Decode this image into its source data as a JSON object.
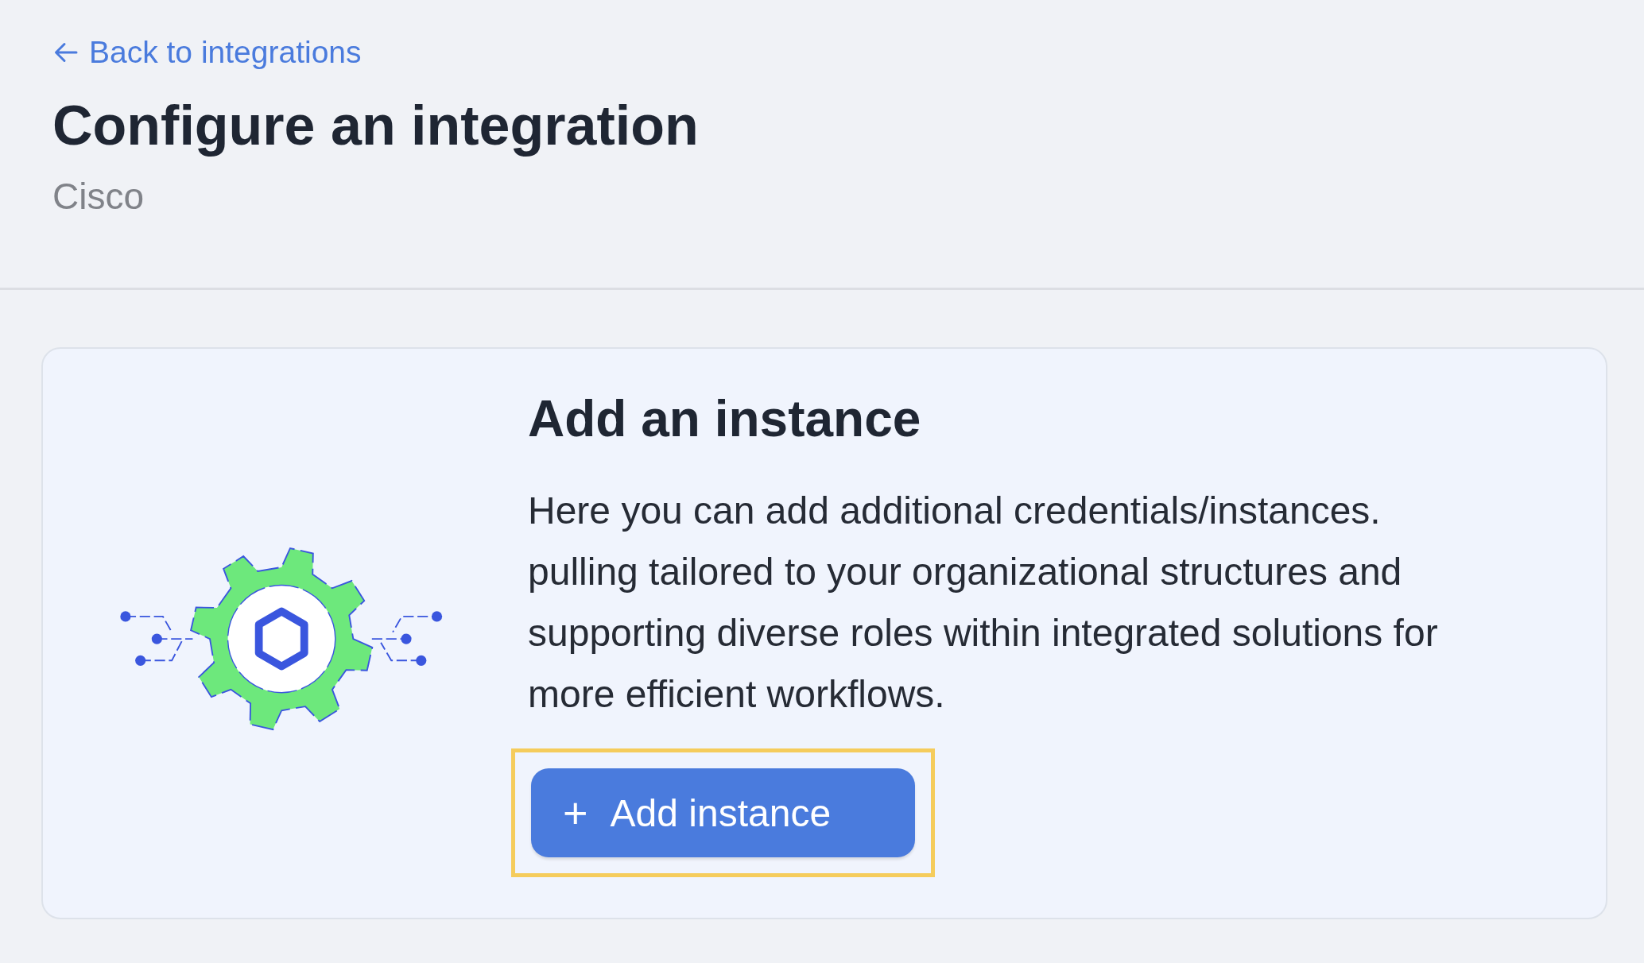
{
  "header": {
    "back_link": "Back to integrations",
    "title": "Configure an integration",
    "subtitle": "Cisco"
  },
  "card": {
    "title": "Add an instance",
    "description": "Here you can add additional credentials/instances. pulling tailored to your organizational structures and supporting diverse roles within integrated solutions for more efficient workflows.",
    "button": {
      "label": "Add instance",
      "icon": "+",
      "highlighted": true
    }
  }
}
